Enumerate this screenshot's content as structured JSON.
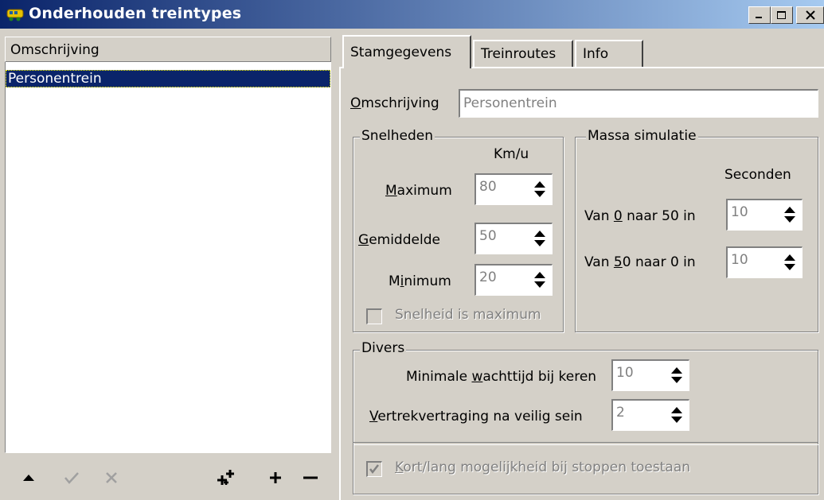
{
  "window": {
    "title": "Onderhouden treintypes"
  },
  "list": {
    "header": "Omschrijving",
    "items": [
      "Personentrein"
    ],
    "toolbar": [
      "move-up",
      "confirm",
      "cancel",
      "add-multiple",
      "add",
      "remove"
    ]
  },
  "tabs": [
    "Stamgegevens",
    "Treinroutes",
    "Info"
  ],
  "stamgegevens": {
    "omschrijving_label_prefix": "O",
    "omschrijving_label_rest": "mschrijving",
    "omschrijving_value": "Personentrein",
    "snelheden": {
      "title": "Snelheden",
      "unit": "Km/u",
      "maximum": {
        "u": "M",
        "rest": "aximum",
        "value": "80"
      },
      "gemiddelde": {
        "u": "G",
        "rest": "emiddelde",
        "value": "50"
      },
      "minimum": {
        "pre": "M",
        "u": "i",
        "rest": "nimum",
        "value": "20"
      },
      "checkbox_label": "Snelheid is maximum"
    },
    "massa": {
      "title": "Massa simulatie",
      "unit": "Seconden",
      "row1": {
        "pre": "Van ",
        "u": "0",
        "rest": " naar 50 in",
        "value": "10"
      },
      "row2": {
        "pre": "Van ",
        "u": "5",
        "rest": "0 naar 0 in",
        "value": "10"
      }
    },
    "divers": {
      "title": "Divers",
      "wachttijd": {
        "pre": "Minimale ",
        "u": "w",
        "rest": "achttijd bij keren",
        "value": "10"
      },
      "vertrek": {
        "u": "V",
        "rest": "ertrekvertraging na veilig sein",
        "value": "2"
      },
      "kort_lang": {
        "u": "K",
        "rest": "ort/lang mogelijkheid bij stoppen toestaan",
        "checked": true
      }
    }
  },
  "colors": {
    "titlebar_start": "#0a246a",
    "titlebar_end": "#a6caf0",
    "selection": "#0a246a"
  }
}
